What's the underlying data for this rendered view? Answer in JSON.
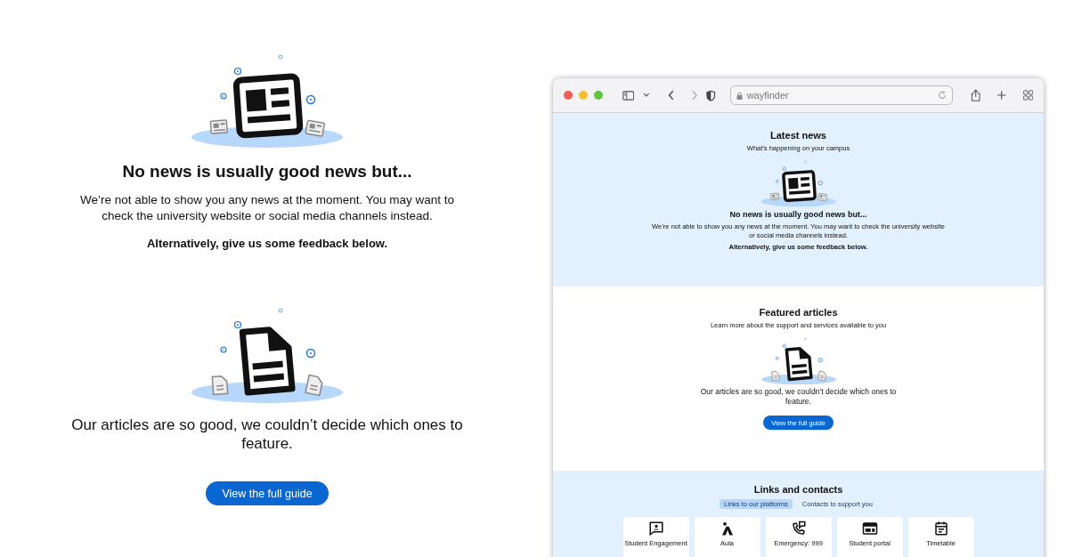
{
  "showcase": {
    "news": {
      "heading": "No news is usually good news but...",
      "body": "We’re not able to show you any news at the moment. You may want to check the university website or social media channels instead.",
      "feedback": "Alternatively, give us some feedback below."
    },
    "articles": {
      "heading": "Our articles are so good, we couldn’t decide which ones to feature.",
      "button": "View the full guide"
    }
  },
  "browser": {
    "address": "wayfinder",
    "news_section": {
      "title": "Latest news",
      "subtitle": "What’s happening on your campus",
      "heading": "No news is usually good news but...",
      "body": "We’re not able to show you any news at the moment. You may want to check the university website or social media channels instead.",
      "feedback": "Alternatively, give us some feedback below."
    },
    "featured_section": {
      "title": "Featured articles",
      "subtitle": "Learn more about the support and services available to you",
      "heading": "Our articles are so good, we couldn’t decide which ones to feature.",
      "button": "View the full guide"
    },
    "links_section": {
      "title": "Links and contacts",
      "tabs": [
        {
          "label": "Links to our platforms",
          "selected": true
        },
        {
          "label": "Contacts to support you",
          "selected": false
        }
      ],
      "tiles": [
        {
          "kind": "chat",
          "label": "Student Engagement"
        },
        {
          "kind": "aula",
          "label": "Aula"
        },
        {
          "kind": "phone",
          "label": "Emergency: 999"
        },
        {
          "kind": "portal",
          "label": "Student portal"
        },
        {
          "kind": "calendar",
          "label": "Timetable"
        }
      ]
    }
  }
}
